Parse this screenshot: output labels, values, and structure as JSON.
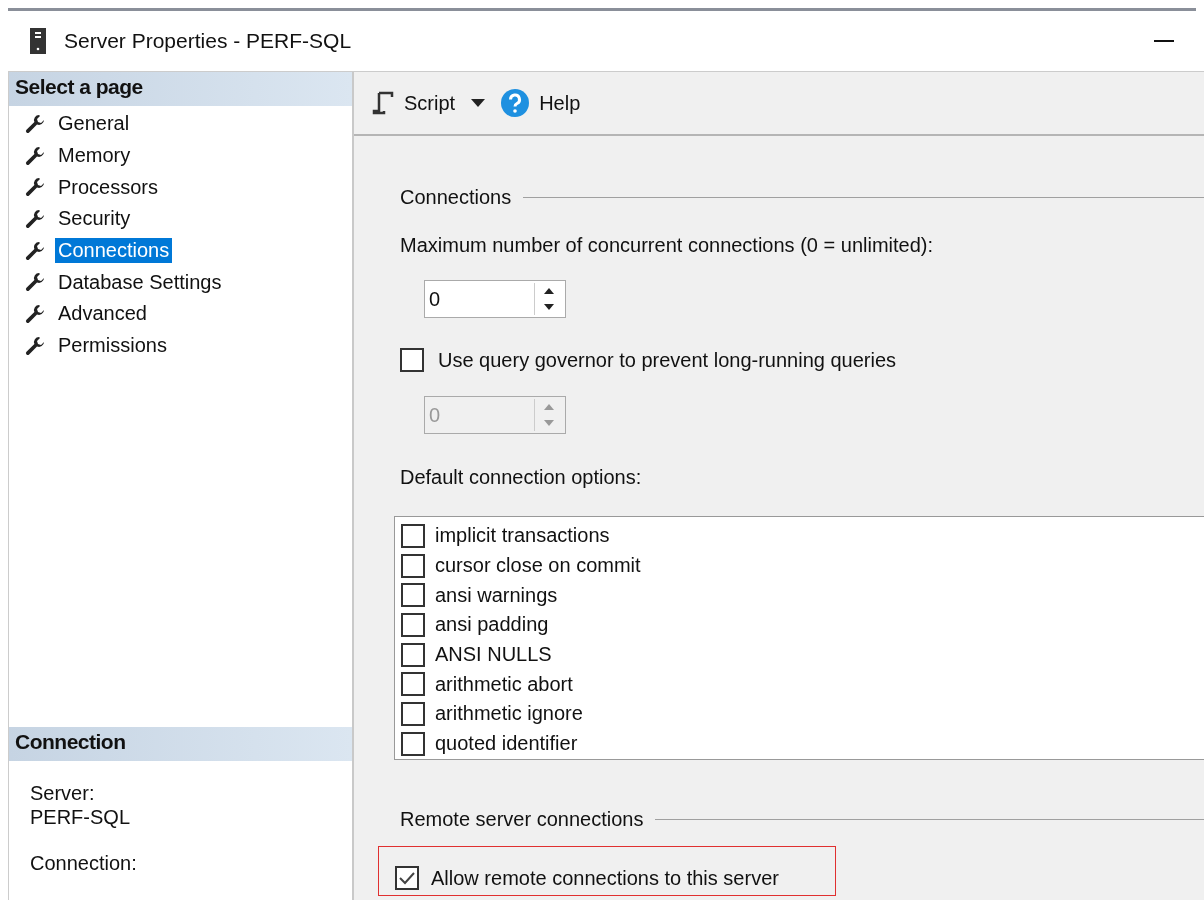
{
  "window": {
    "title": "Server Properties - PERF-SQL"
  },
  "sidebar": {
    "header": "Select a page",
    "items": [
      {
        "label": "General",
        "selected": false
      },
      {
        "label": "Memory",
        "selected": false
      },
      {
        "label": "Processors",
        "selected": false
      },
      {
        "label": "Security",
        "selected": false
      },
      {
        "label": "Connections",
        "selected": true
      },
      {
        "label": "Database Settings",
        "selected": false
      },
      {
        "label": "Advanced",
        "selected": false
      },
      {
        "label": "Permissions",
        "selected": false
      }
    ]
  },
  "connection_panel": {
    "header": "Connection",
    "fields": [
      {
        "label": "Server:",
        "value": "PERF-SQL"
      },
      {
        "label": "Connection:"
      }
    ]
  },
  "toolbar": {
    "script": "Script",
    "help": "Help"
  },
  "connections": {
    "title": "Connections",
    "max_label": "Maximum number of concurrent connections (0 = unlimited):",
    "max_value": "0",
    "governor": {
      "label": "Use query governor to prevent long-running queries",
      "checked": false
    },
    "governor_value": "0",
    "governor_disabled": true,
    "options_label": "Default connection options:",
    "options": [
      {
        "label": "implicit transactions",
        "checked": false
      },
      {
        "label": "cursor close on commit",
        "checked": false
      },
      {
        "label": "ansi warnings",
        "checked": false
      },
      {
        "label": "ansi padding",
        "checked": false
      },
      {
        "label": "ANSI NULLS",
        "checked": false
      },
      {
        "label": "arithmetic abort",
        "checked": false
      },
      {
        "label": "arithmetic ignore",
        "checked": false
      },
      {
        "label": "quoted identifier",
        "checked": false
      }
    ]
  },
  "remote": {
    "title": "Remote server connections",
    "allow": {
      "label": "Allow remote connections to this server",
      "checked": true
    }
  }
}
